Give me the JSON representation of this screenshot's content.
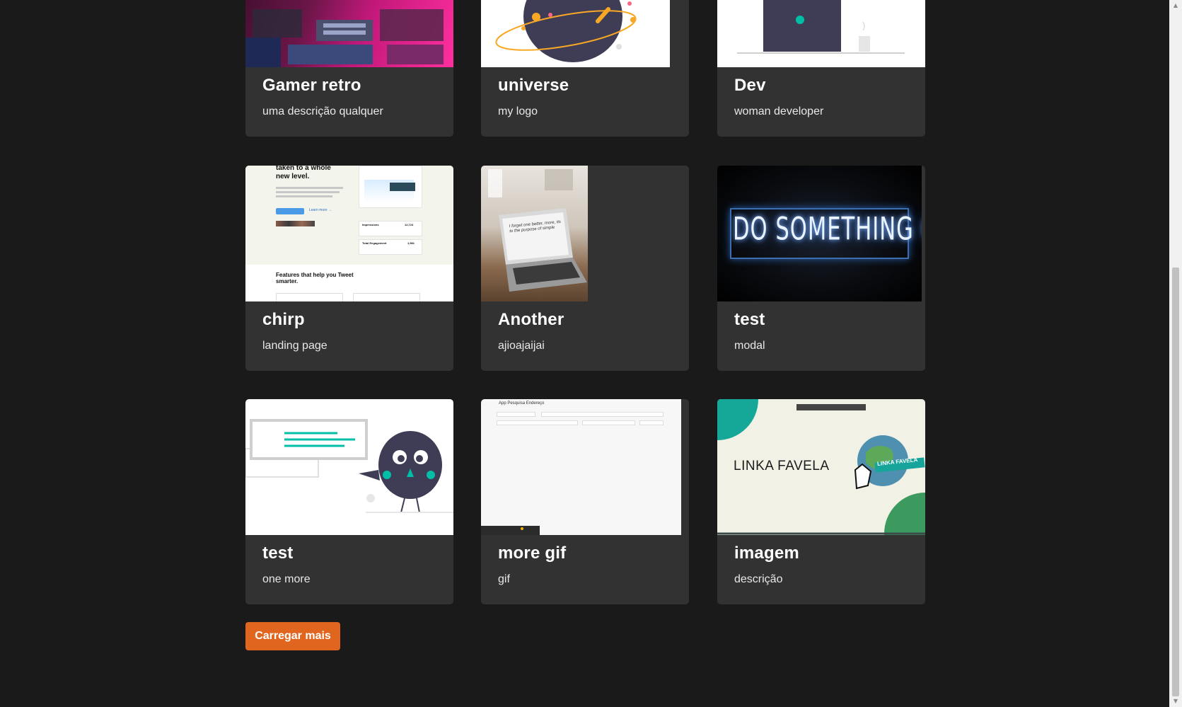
{
  "cards": [
    {
      "title": "Gamer retro",
      "description": "uma descrição qualquer",
      "image": "retro-consoles-image"
    },
    {
      "title": "universe",
      "description": "my logo",
      "image": "universe-illustration"
    },
    {
      "title": "Dev",
      "description": "woman developer",
      "image": "developer-illustration"
    },
    {
      "title": "chirp",
      "description": "landing page",
      "image": "chirp-landing-screenshot"
    },
    {
      "title": "Another",
      "description": "ajioajaijai",
      "image": "laptop-photo"
    },
    {
      "title": "test",
      "description": "modal",
      "image": "neon-sign-photo"
    },
    {
      "title": "test",
      "description": "one more",
      "image": "bird-illustration"
    },
    {
      "title": "more gif",
      "description": "gif",
      "image": "address-app-screenshot"
    },
    {
      "title": "imagem",
      "description": "descrição",
      "image": "linka-favela-banner"
    }
  ],
  "load_more_label": "Carregar mais",
  "thumbs": {
    "chirp": {
      "heading": "taken to a whole new level.",
      "features": "Features that help you Tweet smarter.",
      "learn_more": "Learn more →",
      "stat1_label": "Impressions",
      "stat1_value": "12,724",
      "stat2_label": "Total Engagement",
      "stat2_value": "1,981"
    },
    "laptop": {
      "screen_text": "I forget one better, more, its to the purpose of simple"
    },
    "neon": {
      "sign_text": "DO SOMETHING GREAT"
    },
    "gif_app": {
      "title": "App Pesquisa Endereço"
    },
    "linka": {
      "banner_text": "LINKA FAVELA",
      "globe_label": "LINKA FAVELA"
    }
  },
  "colors": {
    "background": "#1a1a1a",
    "card": "#333232",
    "button": "#e0661f"
  }
}
